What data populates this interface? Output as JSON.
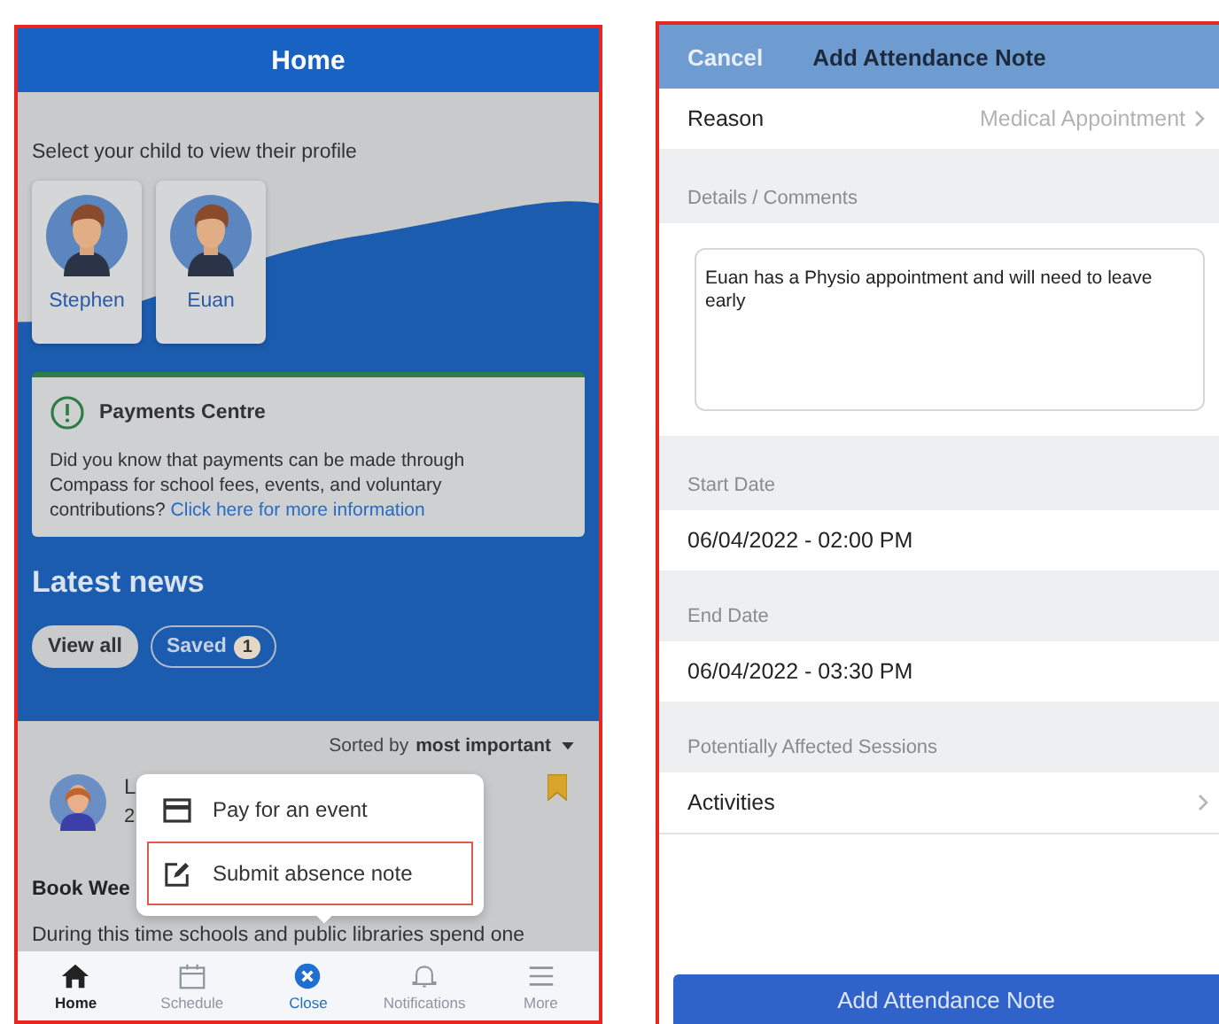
{
  "home_screen": {
    "title": "Home",
    "child_prompt": "Select your child to view their profile",
    "children": [
      {
        "name": "Stephen"
      },
      {
        "name": "Euan"
      }
    ],
    "payments_card": {
      "title": "Payments Centre",
      "text": "Did you know that payments can be made through Compass for school fees, events, and voluntary contributions?",
      "link": "Click here for more information"
    },
    "news": {
      "heading": "Latest news",
      "filters": [
        {
          "label": "View all",
          "selected": true
        },
        {
          "label": "Saved",
          "badge": "1",
          "selected": false
        }
      ],
      "sort_label": "Sorted by",
      "sort_value": "most important",
      "item": {
        "author": "L",
        "date": "2",
        "title": "Book Wee",
        "excerpt": "During this time schools and public libraries spend one",
        "saved": true
      }
    },
    "popup_menu": [
      {
        "label": "Pay for an event",
        "kind": "card",
        "selected": false
      },
      {
        "label": "Submit absence note",
        "kind": "note",
        "selected": true
      }
    ],
    "tab_bar": [
      {
        "label": "Home",
        "kind": "home",
        "selected": true,
        "disabled": false
      },
      {
        "label": "Schedule",
        "kind": "calendar",
        "selected": false,
        "disabled": true
      },
      {
        "label": "Close",
        "kind": "close",
        "selected": false,
        "disabled": false
      },
      {
        "label": "Notifications",
        "kind": "bell",
        "selected": false,
        "disabled": true
      },
      {
        "label": "More",
        "kind": "menu",
        "selected": false,
        "disabled": true
      }
    ]
  },
  "attendance_form": {
    "cancel": "Cancel",
    "title": "Add Attendance Note",
    "reason": {
      "label": "Reason",
      "value": "Medical Appointment"
    },
    "details_label": "Details / Comments",
    "details_value": "Euan has a Physio appointment and will need to leave early",
    "start_label": "Start Date",
    "start_value": "06/04/2022 - 02:00 PM",
    "end_label": "End Date",
    "end_value": "06/04/2022 - 03:30 PM",
    "sessions_label": "Potentially Affected Sessions",
    "sessions_row": "Activities",
    "submit": "Add Attendance Note"
  }
}
